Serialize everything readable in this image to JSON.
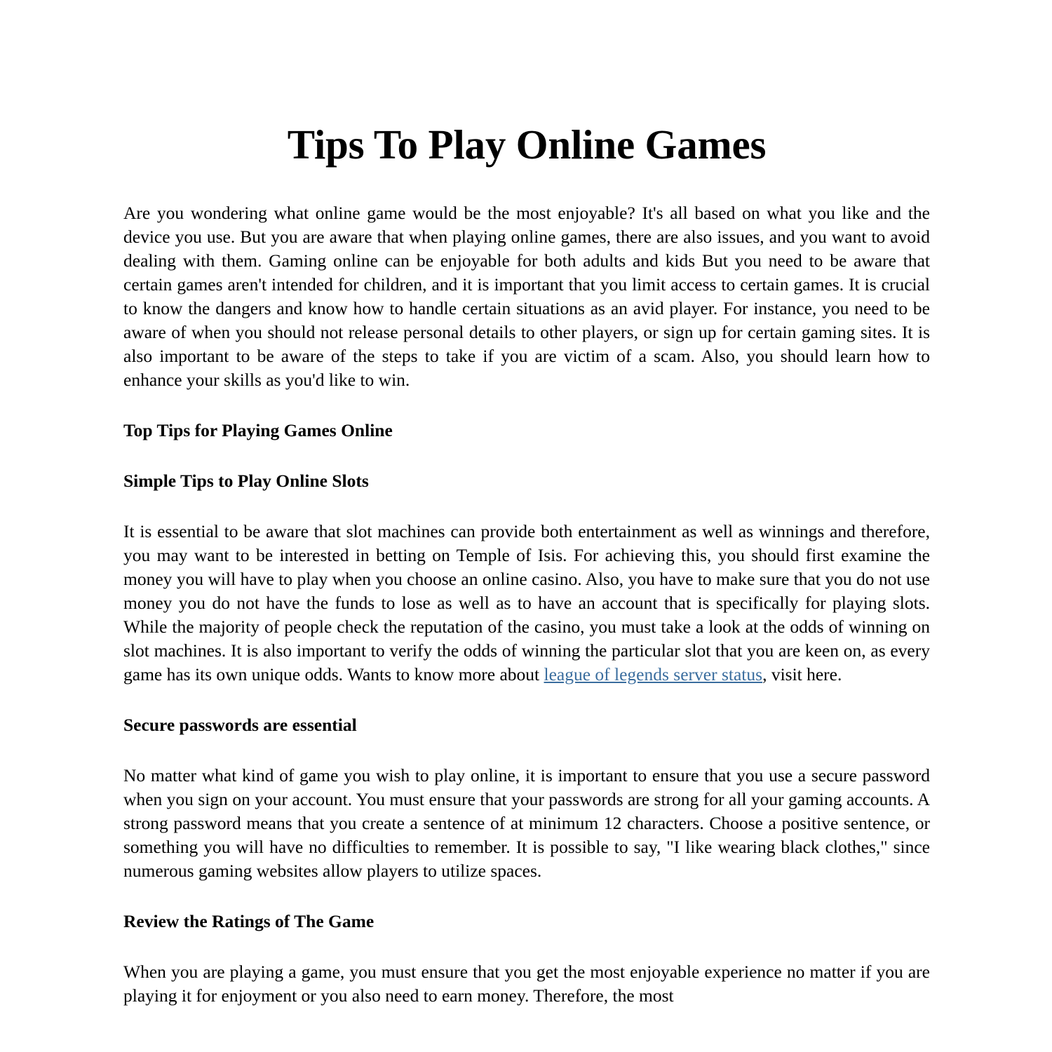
{
  "document": {
    "title": "Tips To Play Online Games",
    "link_color": "#3a6d9e",
    "text_color": "#000000",
    "background_color": "#ffffff"
  },
  "body": {
    "paragraph_1": "Are you wondering what online game would be the most enjoyable? It's all based on what you like and the device you use. But you are aware that when playing online games, there are also issues, and you want to avoid dealing with them. Gaming online can be enjoyable for both adults and kids But you need to be aware that certain games aren't intended for children, and it is important that you limit access to certain games. It is crucial to know the dangers and know how to handle certain situations as an avid player. For instance, you need to be aware of when you should not release personal details to other players, or sign up for certain gaming sites. It is also important to be aware of the steps to take if you are victim of a scam. Also, you should learn how to enhance your skills as you'd like to win.",
    "heading_1": "Top Tips for Playing Games Online",
    "heading_2": "Simple Tips to Play Online Slots",
    "paragraph_2_part1": "It is essential to be aware that slot machines can provide both entertainment as well as winnings and therefore, you may want to be interested in betting on Temple of Isis. For achieving this, you should first examine the money you will have to play when you choose an online casino. Also, you have to make sure that you do not use money you do not have the funds to lose as well as to have an account that is specifically for playing slots. While the majority of people check the reputation of the casino, you must take a look at the odds of winning on slot machines. It is also important to verify the odds of winning the particular slot that you are keen on, as every game has its own unique odds. Wants to know more about ",
    "paragraph_2_link": "league of legends server status",
    "paragraph_2_part2": ", visit here.",
    "heading_3": "Secure passwords are essential",
    "paragraph_3": "No matter what kind of game you wish to play online, it is important to ensure that you use a secure password when you sign on your account. You must ensure that your passwords are strong for all your gaming accounts. A strong password means that you create a sentence of at minimum 12 characters. Choose a positive sentence, or something you will have no difficulties to remember. It is possible to say, \"I like wearing black clothes,\" since numerous gaming websites allow players to utilize spaces.",
    "heading_4": "Review the Ratings of The Game",
    "paragraph_4": "When you are playing a game, you must ensure that you get the most enjoyable experience no matter if you are playing it for enjoyment or you also need to earn money. Therefore, the most"
  }
}
